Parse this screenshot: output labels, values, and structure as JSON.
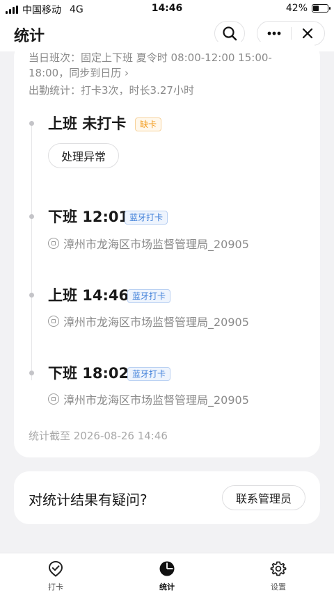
{
  "status_bar": {
    "carrier": "中国移动",
    "network": "4G",
    "time": "14:46",
    "battery": "42%",
    "battery_level": 0.42
  },
  "nav": {
    "title": "统计",
    "search_icon": "search-icon",
    "more_icon": "more-icon",
    "close_icon": "close-icon"
  },
  "summary": {
    "shift_line": "当日班次：固定上下班 夏令时 08:00-12:00 15:00-18:00，同步到日历 ›",
    "attendance_line": "出勤统计：打卡3次，时长3.27小时"
  },
  "records": [
    {
      "title": "上班 未打卡",
      "tag": "缺卡",
      "action": "处理异常"
    },
    {
      "title": "下班 12:01",
      "tag": "蓝牙打卡",
      "location": "漳州市龙海区市场监督管理局_20905"
    },
    {
      "title": "上班 14:46",
      "tag": "蓝牙打卡",
      "location": "漳州市龙海区市场监督管理局_20905"
    },
    {
      "title": "下班 18:02",
      "tag": "蓝牙打卡",
      "location": "漳州市龙海区市场监督管理局_20905"
    }
  ],
  "footer_note": "统计截至 2026-08-26 14:46",
  "question": {
    "text": "对统计结果有疑问?",
    "button": "联系管理员"
  },
  "tabs": [
    {
      "label": "打卡",
      "icon": "check-badge-icon",
      "active": false
    },
    {
      "label": "统计",
      "icon": "pie-chart-icon",
      "active": true
    },
    {
      "label": "设置",
      "icon": "gear-icon",
      "active": false
    }
  ],
  "colors": {
    "background": "#f2f2f4",
    "warn_tag": "#f29a1a",
    "blue_tag": "#3f7fd9"
  }
}
